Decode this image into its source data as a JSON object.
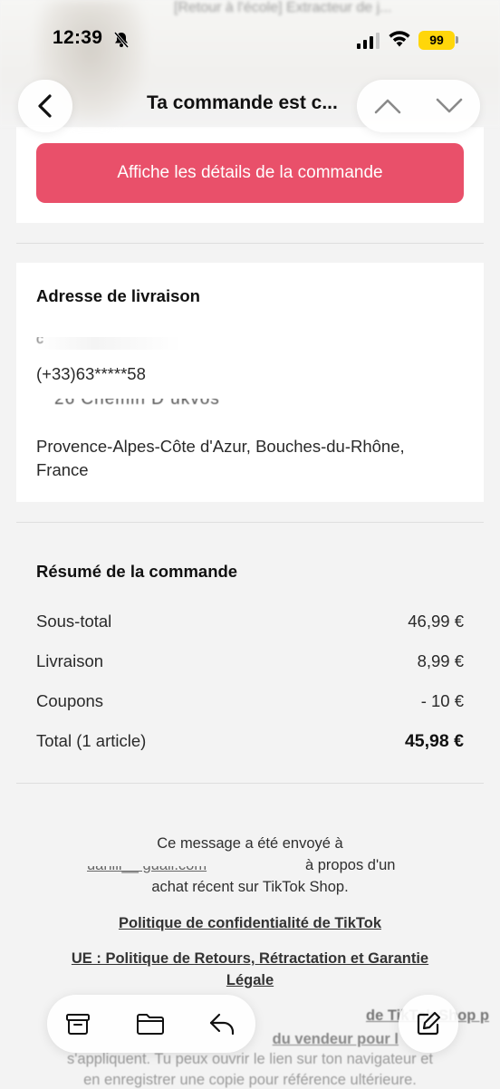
{
  "status": {
    "time": "12:39",
    "battery": "99"
  },
  "background_product_title": "[Retour à l'école] Extracteur de j...",
  "nav": {
    "title": "Ta commande est c..."
  },
  "cta": {
    "label": "Affiche les détails de la commande"
  },
  "address": {
    "title": "Adresse de livraison",
    "phone": "(+33)63*****58",
    "region": "Provence-Alpes-Côte d'Azur, Bouches-du-Rhône,",
    "country": "France"
  },
  "summary": {
    "title": "Résumé de la commande",
    "rows": [
      {
        "label": "Sous-total",
        "value": "46,99 €"
      },
      {
        "label": "Livraison",
        "value": "8,99 €"
      },
      {
        "label": "Coupons",
        "value": "- 10 €"
      },
      {
        "label": "Total (1 article)",
        "value": "45,98 €"
      }
    ]
  },
  "footer": {
    "line1": "Ce message a été envoyé à",
    "line2_suffix": "à propos d'un",
    "line3": "achat récent sur TikTok Shop.",
    "privacy_link": "Politique de confidentialité de TikTok",
    "returns_link_1": "UE : Politique de Retours, Rétractation et Garantie",
    "returns_link_2": "Légale",
    "partial_1": "de TikTok Shop p",
    "partial_2": "du vendeur pour l",
    "line_open": "s'appliquent. Tu peux ouvrir le lien sur ton navigateur et",
    "line_save": "en enregistrer une copie pour référence ultérieure."
  },
  "colors": {
    "accent": "#e9506a",
    "battery": "#ffd60a"
  }
}
